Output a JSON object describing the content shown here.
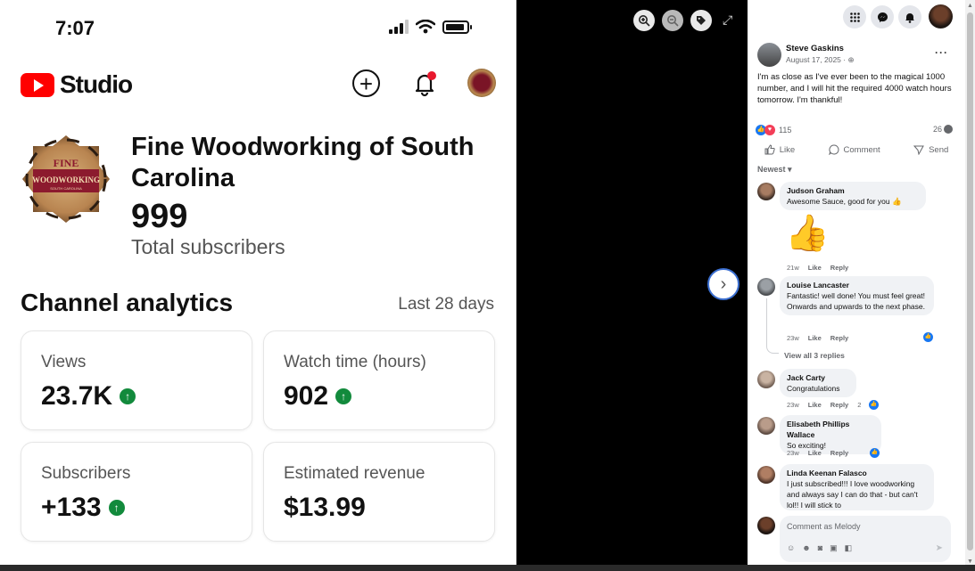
{
  "phone": {
    "status_time": "7:07",
    "studio_logo_text": "Studio",
    "channel": {
      "name": "Fine Woodworking of South Carolina",
      "subscribers": "999",
      "subscribers_label": "Total subscribers",
      "logo_line1": "FINE",
      "logo_line2": "WOODWORKING",
      "logo_line3": "SOUTH CAROLINA"
    },
    "analytics": {
      "title": "Channel analytics",
      "range": "Last 28 days",
      "cards": [
        {
          "label": "Views",
          "value": "23.7K"
        },
        {
          "label": "Watch time (hours)",
          "value": "902"
        },
        {
          "label": "Subscribers",
          "value": "+133"
        },
        {
          "label": "Estimated revenue",
          "value": "$13.99"
        }
      ]
    },
    "colors": {
      "brand_red": "#ff0000",
      "trend_green": "#128a3c",
      "notification_dot": "#e8182d"
    }
  },
  "viewer": {
    "icons": [
      "zoom-in-icon",
      "zoom-out-icon",
      "tag-icon",
      "expand-icon",
      "next-arrow-icon"
    ]
  },
  "fb": {
    "post": {
      "author": "Steve Gaskins",
      "date": "August 17, 2025 · ",
      "text": "I'm as close as I've ever been to the magical 1000 number, and I will hit the required 4000 watch hours tomorrow. I'm thankful!",
      "reactions": "115",
      "comments": "26"
    },
    "actions": {
      "like": "Like",
      "comment": "Comment",
      "send": "Send"
    },
    "sort_label": "Newest",
    "comments": [
      {
        "author": "Judson Graham",
        "text": "Awesome Sauce, good for you 👍",
        "age": "21w",
        "like": "Like",
        "reply": "Reply"
      },
      {
        "author": "Louise Lancaster",
        "text": "Fantastic! well done! You must feel great! Onwards and upwards to the next phase.",
        "age": "23w",
        "like": "Like",
        "reply": "Reply"
      },
      {
        "author": "Jack Carty",
        "text": "Congratulations",
        "age": "23w",
        "like": "Like",
        "reply": "Reply",
        "likes": "2"
      },
      {
        "author": "Elisabeth Phillips Wallace",
        "text": "So exciting!",
        "age": "23w",
        "like": "Like",
        "reply": "Reply"
      },
      {
        "author": "Linda Keenan Falasco",
        "text": "I just subscribed!!! I love woodworking and always say I can do that - but can't lol!! I will stick to"
      }
    ],
    "view_replies": "View all 3 replies",
    "composer_placeholder": "Comment as Melody",
    "colors": {
      "fb_blue": "#1877f2",
      "love_red": "#f33e58"
    }
  }
}
